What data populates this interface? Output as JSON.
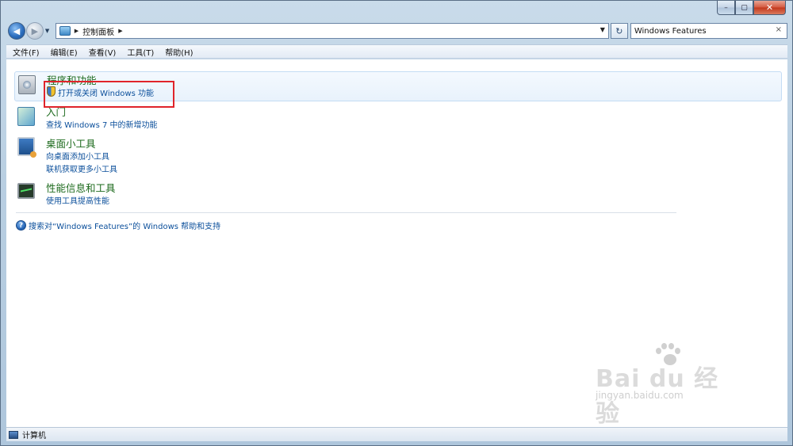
{
  "window": {
    "minimize_glyph": "–",
    "maximize_glyph": "▢",
    "close_glyph": "✕"
  },
  "nav": {
    "back_glyph": "◀",
    "forward_glyph": "▶",
    "history_glyph": "▼",
    "breadcrumb": "控制面板",
    "refresh_glyph": "↻",
    "search_value": "Windows Features",
    "search_clear": "×"
  },
  "menu": [
    "文件(F)",
    "编辑(E)",
    "查看(V)",
    "工具(T)",
    "帮助(H)"
  ],
  "results": [
    {
      "title": "程序和功能",
      "icon": "programs-icon",
      "links": [
        "打开或关闭 Windows 功能"
      ]
    },
    {
      "title": "入门",
      "icon": "getting-started-icon",
      "links": [
        "查找 Windows 7 中的新增功能"
      ]
    },
    {
      "title": "桌面小工具",
      "icon": "gadgets-icon",
      "links": [
        "向桌面添加小工具",
        "联机获取更多小工具"
      ]
    },
    {
      "title": "性能信息和工具",
      "icon": "performance-icon",
      "links": [
        "使用工具提高性能"
      ]
    }
  ],
  "help": {
    "text": "搜索对“Windows Features”的 Windows 帮助和支持"
  },
  "status": {
    "text": "计算机"
  },
  "watermark": {
    "brand": "Bai du 经验",
    "url": "jingyan.baidu.com"
  },
  "colors": {
    "group_title": "#1e6b1e",
    "link": "#0b4f9b",
    "highlight_border": "#e0242a"
  }
}
